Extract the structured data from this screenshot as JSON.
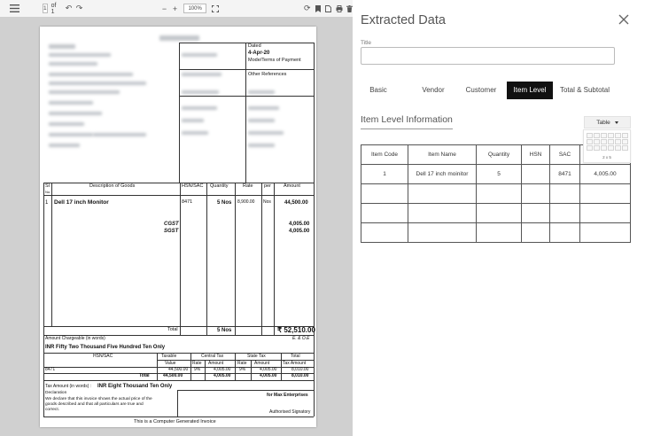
{
  "viewer": {
    "toolbar": {
      "page_current": "1",
      "page_of": "of 1",
      "zoom": "100%"
    },
    "invoice": {
      "dated_label": "Dated",
      "dated_value": "4-Apr-20",
      "mode_label": "Mode/Terms of Payment",
      "other_ref_label": "Other References",
      "col_sl": "Sl",
      "col_sl_2": "No.",
      "col_desc": "Description of Goods",
      "col_hsn": "HSN/SAC",
      "col_qty": "Quantity",
      "col_rate": "Rate",
      "col_per": "per",
      "col_amount": "Amount",
      "row_no": "1",
      "row_desc": "Dell 17 inch Monitor",
      "row_hsn": "8471",
      "row_qty": "5 Nos",
      "row_rate": "8,900.00",
      "row_per": "Nos",
      "row_amount": "44,500.00",
      "cgst_label": "CGST",
      "sgst_label": "SGST",
      "cgst_amount": "4,005.00",
      "sgst_amount": "4,005.00",
      "total_label": "Total",
      "total_qty": "5 Nos",
      "total_amount": "₹ 52,510.00",
      "amount_words_label": "Amount Chargeable (in words)",
      "eoe": "E. & O.E",
      "amount_words": "INR Fifty Two Thousand Five Hundred Ten Only",
      "tax_hsn": "HSN/SAC",
      "tax_taxable": "Taxable",
      "tax_value": "Value",
      "tax_central": "Central Tax",
      "tax_state": "State Tax",
      "tax_total": "Total",
      "tax_rate": "Rate",
      "tax_amount": "Amount",
      "tax_amount_total": "Tax Amount",
      "tax_row_hsn": "8471",
      "tax_row_taxable": "44,500.00",
      "tax_row_c_rate": "9%",
      "tax_row_c_amt": "4,005.00",
      "tax_row_s_rate": "9%",
      "tax_row_s_amt": "4,005.00",
      "tax_row_total": "8,010.00",
      "tax_total_label": "Total",
      "tax_total_taxable": "44,500.00",
      "tax_total_c_amt": "4,005.00",
      "tax_total_s_amt": "4,005.00",
      "tax_total_total": "8,010.00",
      "tax_words_label": "Tax Amount (in words) :",
      "tax_words": "INR Eight Thousand Ten Only",
      "declaration_label": "Declaration",
      "declaration_1": "We declare that this invoice shows the actual price of the",
      "declaration_2": "goods described and that all particulars are true and",
      "declaration_3": "correct.",
      "for_company": "for Max Enterprises",
      "signatory": "Authorised Signatory",
      "footer": "This is a Computer Generated Invoice"
    }
  },
  "panel": {
    "title": "Extracted Data",
    "field_label": "Title",
    "title_value": "",
    "tabs": [
      {
        "label": "Basic"
      },
      {
        "label": "Vendor"
      },
      {
        "label": "Customer"
      },
      {
        "label": "Item Level"
      },
      {
        "label": "Total & Subtotal"
      }
    ],
    "active_tab": "Item Level",
    "section_title": "Item Level Information",
    "view_mode": "Table",
    "grid_size": "2 x 5",
    "table": {
      "headers": [
        "Item Code",
        "Item Name",
        "Quantity",
        "HSN",
        "SAC",
        ""
      ],
      "rows": [
        [
          "1",
          "Dell 17 inch moinitor",
          "5",
          "",
          "8471",
          "4,005.00"
        ],
        [
          "",
          "",
          "",
          "",
          "",
          ""
        ],
        [
          "",
          "",
          "",
          "",
          "",
          ""
        ],
        [
          "",
          "",
          "",
          "",
          "",
          ""
        ]
      ]
    }
  }
}
